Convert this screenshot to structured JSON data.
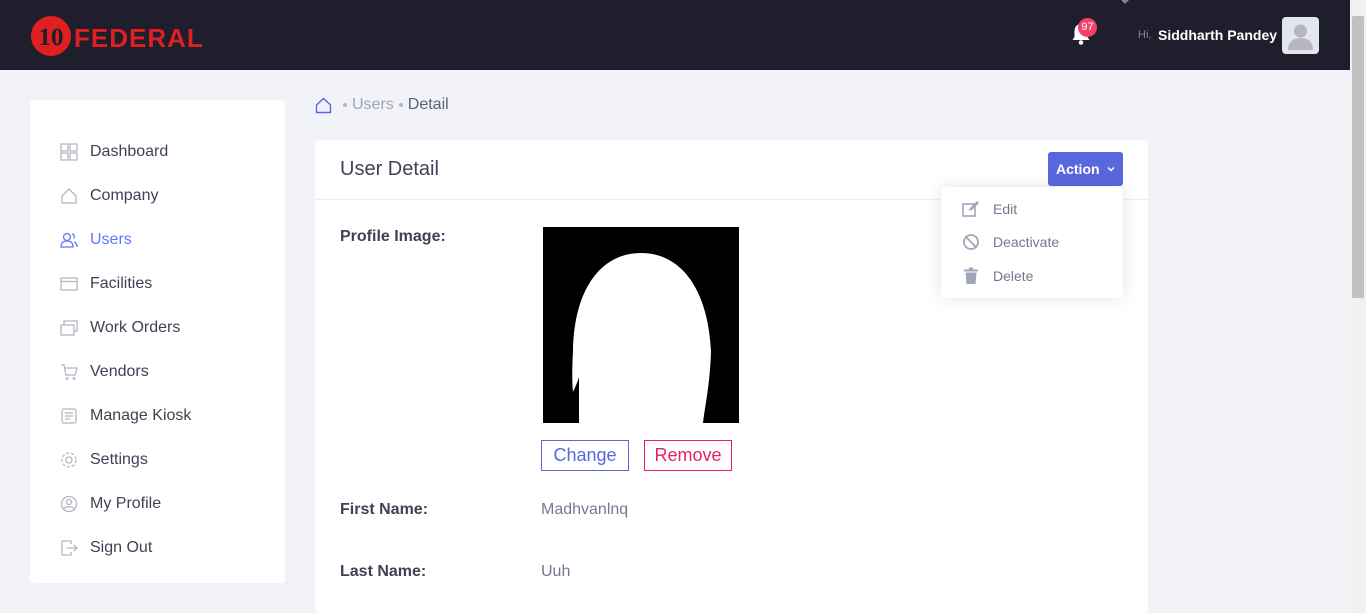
{
  "brand": {
    "logo_number": "10",
    "logo_text": "FEDERAL"
  },
  "header": {
    "notification_count": "97",
    "greeting": "Hi,",
    "user_name": "Siddharth Pandey"
  },
  "sidebar": {
    "items": [
      {
        "label": "Dashboard",
        "icon": "dashboard-icon"
      },
      {
        "label": "Company",
        "icon": "home-icon"
      },
      {
        "label": "Users",
        "icon": "users-icon",
        "active": true
      },
      {
        "label": "Facilities",
        "icon": "facilities-icon"
      },
      {
        "label": "Work Orders",
        "icon": "work-orders-icon"
      },
      {
        "label": "Vendors",
        "icon": "cart-icon"
      },
      {
        "label": "Manage Kiosk",
        "icon": "kiosk-icon"
      },
      {
        "label": "Settings",
        "icon": "gear-icon"
      },
      {
        "label": "My Profile",
        "icon": "user-circle-icon"
      },
      {
        "label": "Sign Out",
        "icon": "sign-out-icon"
      }
    ]
  },
  "breadcrumb": {
    "items": [
      "Users",
      "Detail"
    ]
  },
  "card": {
    "title": "User Detail",
    "action_label": "Action",
    "action_menu": [
      {
        "label": "Edit",
        "icon": "edit-icon"
      },
      {
        "label": "Deactivate",
        "icon": "ban-icon"
      },
      {
        "label": "Delete",
        "icon": "trash-icon"
      }
    ],
    "profile_image_label": "Profile Image:",
    "change_label": "Change",
    "remove_label": "Remove",
    "first_name_label": "First Name:",
    "first_name_value": "Madhvanlnq",
    "last_name_label": "Last Name:",
    "last_name_value": "Uuh"
  },
  "colors": {
    "topbar": "#1e1e2d",
    "brand_red": "#e02020",
    "accent": "#5867dd",
    "active_nav": "#5d78ff",
    "danger": "#e91e63",
    "badge": "#f1416c"
  }
}
